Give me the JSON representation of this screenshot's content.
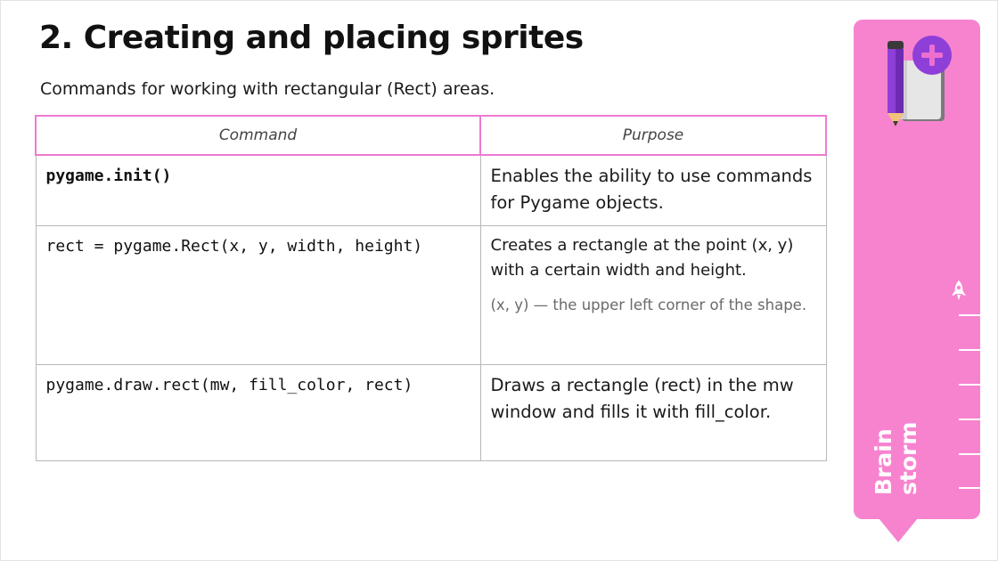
{
  "slide": {
    "title": "2. Creating and placing sprites",
    "subtitle": "Commands for working with rectangular (Rect) areas."
  },
  "table": {
    "headers": [
      "Command",
      "Purpose"
    ],
    "rows": [
      {
        "command": "pygame.init()",
        "purpose": "Enables the ability to use commands for Pygame objects.",
        "note": ""
      },
      {
        "command": "rect = pygame.Rect(x, y, width, height)",
        "purpose": "Creates a rectangle at the point (x, y) with a certain width and height.",
        "note": "(x, y) — the upper left corner of the shape."
      },
      {
        "command": "pygame.draw.rect(mw, fill_color, rect)",
        "purpose": "Draws a rectangle (rect) in the mw window and fills it with fill_color.",
        "note": ""
      }
    ]
  },
  "side_panel": {
    "brand_line1": "Brain",
    "brand_line2": "storm",
    "logo_icon": "notebook-pencil-plus-icon",
    "marker_icon": "rocket-icon",
    "colors": {
      "panel": "#f783cf",
      "header_border": "#ee7ad0",
      "accent_purple": "#8e3fd8"
    }
  }
}
